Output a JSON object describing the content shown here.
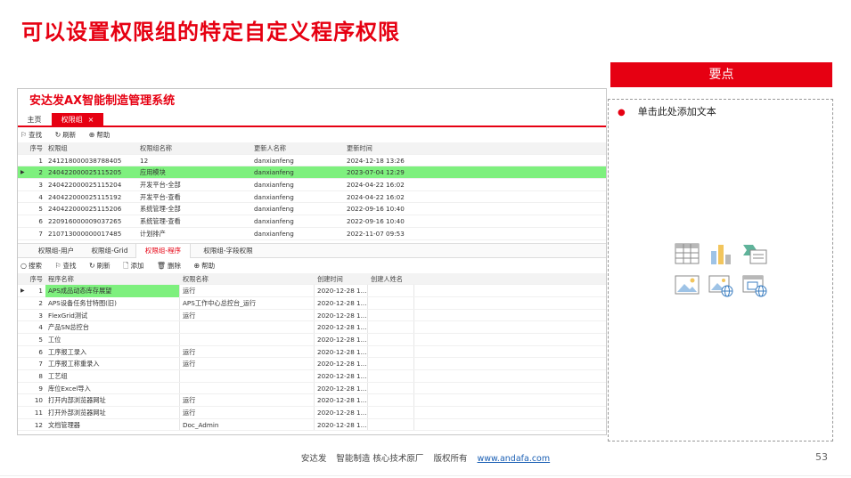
{
  "slide": {
    "title": "可以设置权限组的特定自定义程序权限",
    "page_number": "53",
    "footer": {
      "company": "安达发",
      "slogan": "智能制造 核心技术原厂",
      "rights": "版权所有",
      "url": "www.andafa.com"
    }
  },
  "app": {
    "title": "安达发AX智能制造管理系统",
    "tabs": {
      "home": "主页",
      "active": "权限组",
      "close": "×"
    },
    "toolbar": {
      "search": "查找",
      "refresh": "刷新",
      "help": "帮助"
    },
    "grid1": {
      "columns": [
        "序号",
        "权限组",
        "权限组名称",
        "更新人名称",
        "更新时间"
      ],
      "rows": [
        {
          "no": "1",
          "id": "241218000038788405",
          "name": "12",
          "user": "danxianfeng",
          "time": "2024-12-18 13:26"
        },
        {
          "no": "2",
          "id": "240422000025115205",
          "name": "应用模块",
          "user": "danxianfeng",
          "time": "2023-07-04 12:29"
        },
        {
          "no": "3",
          "id": "240422000025115204",
          "name": "开发平台-全部",
          "user": "danxianfeng",
          "time": "2024-04-22 16:02"
        },
        {
          "no": "4",
          "id": "240422000025115192",
          "name": "开发平台-查看",
          "user": "danxianfeng",
          "time": "2024-04-22 16:02"
        },
        {
          "no": "5",
          "id": "240422000025115206",
          "name": "系统管理-全部",
          "user": "danxianfeng",
          "time": "2022-09-16 10:40"
        },
        {
          "no": "6",
          "id": "220916000009037265",
          "name": "系统管理-查看",
          "user": "danxianfeng",
          "time": "2022-09-16 10:40"
        },
        {
          "no": "7",
          "id": "210713000000017485",
          "name": "计划排产",
          "user": "danxianfeng",
          "time": "2022-11-07 09:53"
        }
      ]
    },
    "subtabs": [
      "权限组-用户",
      "权限组-Grid",
      "权限组-程序",
      "权限组-字段权限"
    ],
    "toolbar2": {
      "search": "搜索",
      "find": "查找",
      "refresh": "刷新",
      "add": "添加",
      "delete": "删除",
      "help": "帮助"
    },
    "grid2": {
      "columns": [
        "序号",
        "程序名称",
        "权限名称",
        "创建时间",
        "创建人姓名"
      ],
      "rows": [
        {
          "no": "1",
          "program": "APS成品动态库存展望",
          "perm": "运行",
          "time": "2020-12-28 1...",
          "creator": ""
        },
        {
          "no": "2",
          "program": "APS设备任务甘特图(旧)",
          "perm": "APS工作中心总控台_运行",
          "time": "2020-12-28 1...",
          "creator": ""
        },
        {
          "no": "3",
          "program": "FlexGrid测试",
          "perm": "运行",
          "time": "2020-12-28 1...",
          "creator": ""
        },
        {
          "no": "4",
          "program": "产品SN总控台",
          "perm": "",
          "time": "2020-12-28 1...",
          "creator": ""
        },
        {
          "no": "5",
          "program": "工位",
          "perm": "",
          "time": "2020-12-28 1...",
          "creator": ""
        },
        {
          "no": "6",
          "program": "工序报工录入",
          "perm": "运行",
          "time": "2020-12-28 1...",
          "creator": ""
        },
        {
          "no": "7",
          "program": "工序报工称重录入",
          "perm": "运行",
          "time": "2020-12-28 1...",
          "creator": ""
        },
        {
          "no": "8",
          "program": "工艺组",
          "perm": "",
          "time": "2020-12-28 1...",
          "creator": ""
        },
        {
          "no": "9",
          "program": "库位Excel导入",
          "perm": "",
          "time": "2020-12-28 1...",
          "creator": ""
        },
        {
          "no": "10",
          "program": "打开内部浏览器网址",
          "perm": "运行",
          "time": "2020-12-28 1...",
          "creator": ""
        },
        {
          "no": "11",
          "program": "打开外部浏览器网址",
          "perm": "运行",
          "time": "2020-12-28 1...",
          "creator": ""
        },
        {
          "no": "12",
          "program": "文档管理器",
          "perm": "Doc_Admin",
          "time": "2020-12-28 1...",
          "creator": ""
        }
      ]
    }
  },
  "keypoints": {
    "header": "要点",
    "item": "单击此处添加文本",
    "icons": [
      "table-icon",
      "chart-icon",
      "smartart-icon",
      "picture-icon",
      "online-picture-icon",
      "video-icon"
    ]
  },
  "colors": {
    "accent": "#e60012",
    "selected_row": "#7ef07e"
  }
}
